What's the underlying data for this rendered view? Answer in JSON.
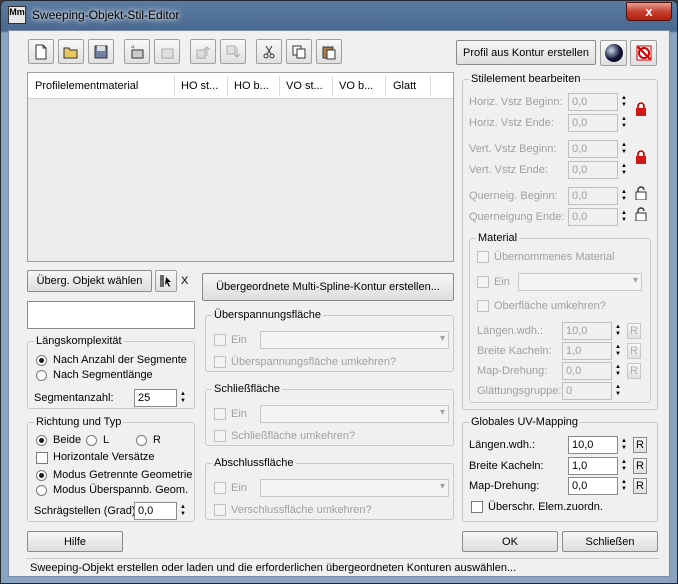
{
  "window": {
    "title": "Sweeping-Objekt-Stil-Editor",
    "icon_text": "Mm",
    "close_label": "x"
  },
  "toolbar": {
    "profile_button": "Profil aus Kontur erstellen"
  },
  "table": {
    "columns": [
      "Profilelementmaterial",
      "HO st...",
      "HO b...",
      "VO st...",
      "VO b...",
      "Glatt"
    ]
  },
  "parent": {
    "pick_button": "Überg. Objekt wählen",
    "x_label": "X",
    "multi_spline_button": "Übergeordnete Multi-Spline-Kontur erstellen..."
  },
  "length_complexity": {
    "label": "Längskomplexität",
    "opt1": "Nach Anzahl der Segmente",
    "opt2": "Nach Segmentlänge",
    "seg_label": "Segmentanzahl:",
    "seg_value": "25"
  },
  "direction": {
    "label": "Richtung und Typ",
    "both": "Beide",
    "l": "L",
    "r": "R",
    "horiz": "Horizontale Versätze",
    "mode1": "Modus Getrennte Geometrie",
    "mode2": "Modus Überspannb. Geom.",
    "slope_label": "Schrägstellen (Grad)",
    "slope_value": "0,0"
  },
  "span": {
    "label": "Überspannungsfläche",
    "on": "Ein",
    "reverse": "Überspannungsfläche umkehren?"
  },
  "close": {
    "label": "Schließfläche",
    "on": "Ein",
    "reverse": "Schließfläche umkehren?"
  },
  "end": {
    "label": "Abschlussfläche",
    "on": "Ein",
    "reverse": "Verschlussfläche umkehren?"
  },
  "style_edit": {
    "label": "Stilelement bearbeiten",
    "rows": [
      {
        "label": "Horiz. Vstz Beginn:",
        "value": "0,0"
      },
      {
        "label": "Horiz. Vstz Ende:",
        "value": "0,0"
      },
      {
        "label": "Vert. Vstz Beginn:",
        "value": "0,0"
      },
      {
        "label": "Vert. Vstz Ende:",
        "value": "0,0"
      },
      {
        "label": "Querneig. Beginn:",
        "value": "0,0"
      },
      {
        "label": "Querneigung Ende:",
        "value": "0,0"
      }
    ]
  },
  "material": {
    "label": "Material",
    "inherited": "Übernommenes Material",
    "on": "Ein",
    "reverse_surface": "Oberfläche umkehren?",
    "len_label": "Längen.wdh.:",
    "len_value": "10,0",
    "width_label": "Breite Kacheln:",
    "width_value": "1,0",
    "rot_label": "Map-Drehung:",
    "rot_value": "0,0",
    "smooth_label": "Glättungsgruppe:",
    "smooth_value": "0",
    "r": "R"
  },
  "global_uv": {
    "label": "Globales UV-Mapping",
    "len_label": "Längen.wdh.:",
    "len_value": "10,0",
    "width_label": "Breite Kacheln:",
    "width_value": "1,0",
    "rot_label": "Map-Drehung:",
    "rot_value": "0,0",
    "override": "Überschr. Elem.zuordn.",
    "r": "R"
  },
  "footer": {
    "help": "Hilfe",
    "ok": "OK",
    "close": "Schließen"
  },
  "status": "Sweeping-Objekt erstellen oder laden und die erforderlichen übergeordneten Konturen auswählen..."
}
